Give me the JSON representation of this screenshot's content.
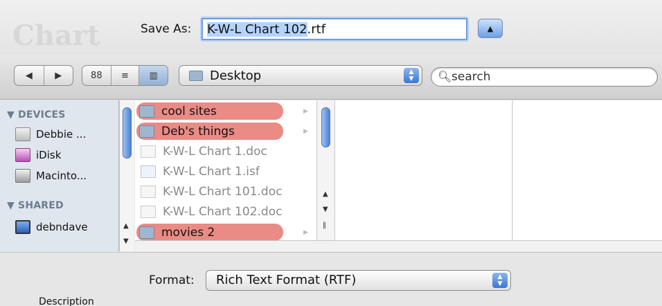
{
  "background_title": "Chart",
  "save_as": {
    "label": "Save As:",
    "filename": "K-W-L Chart 102",
    "extension": ".rtf",
    "expand_glyph": "▲"
  },
  "toolbar": {
    "back_glyph": "◀",
    "forward_glyph": "▶",
    "view_icon_glyph": "88",
    "view_list_glyph": "≡",
    "view_column_glyph": "▥",
    "location": "Desktop",
    "search_placeholder": "search"
  },
  "sidebar": {
    "devices_header": "▼ DEVICES",
    "devices": [
      {
        "label": "Debbie ...",
        "icon": "hard-drive-icon"
      },
      {
        "label": "iDisk",
        "icon": "idisk-icon"
      },
      {
        "label": "Macinto...",
        "icon": "hard-drive-icon"
      }
    ],
    "shared_header": "▼ SHARED",
    "shared": [
      {
        "label": "debndave",
        "icon": "monitor-icon"
      }
    ]
  },
  "files": [
    {
      "name": "cool sites",
      "kind": "folder",
      "label_color": "#ea8b86",
      "dimmed": false
    },
    {
      "name": "Deb's things",
      "kind": "folder",
      "label_color": "#ea8b86",
      "dimmed": false
    },
    {
      "name": "K-W-L Chart 1.doc",
      "kind": "doc",
      "dimmed": true
    },
    {
      "name": "K-W-L Chart 1.isf",
      "kind": "isf",
      "dimmed": true
    },
    {
      "name": "K-W-L Chart 101.doc",
      "kind": "doc",
      "dimmed": true
    },
    {
      "name": "K-W-L Chart 102.doc",
      "kind": "doc",
      "dimmed": true
    },
    {
      "name": "movies 2",
      "kind": "folder",
      "label_color": "#ea8b86",
      "dimmed": false
    }
  ],
  "format": {
    "label": "Format:",
    "value": "Rich Text Format (RTF)"
  },
  "description_label": "Description",
  "colors": {
    "accent_blue": "#4a82d6",
    "tag_red": "#ea8b86",
    "sidebar_bg": "#dfe6ee"
  }
}
